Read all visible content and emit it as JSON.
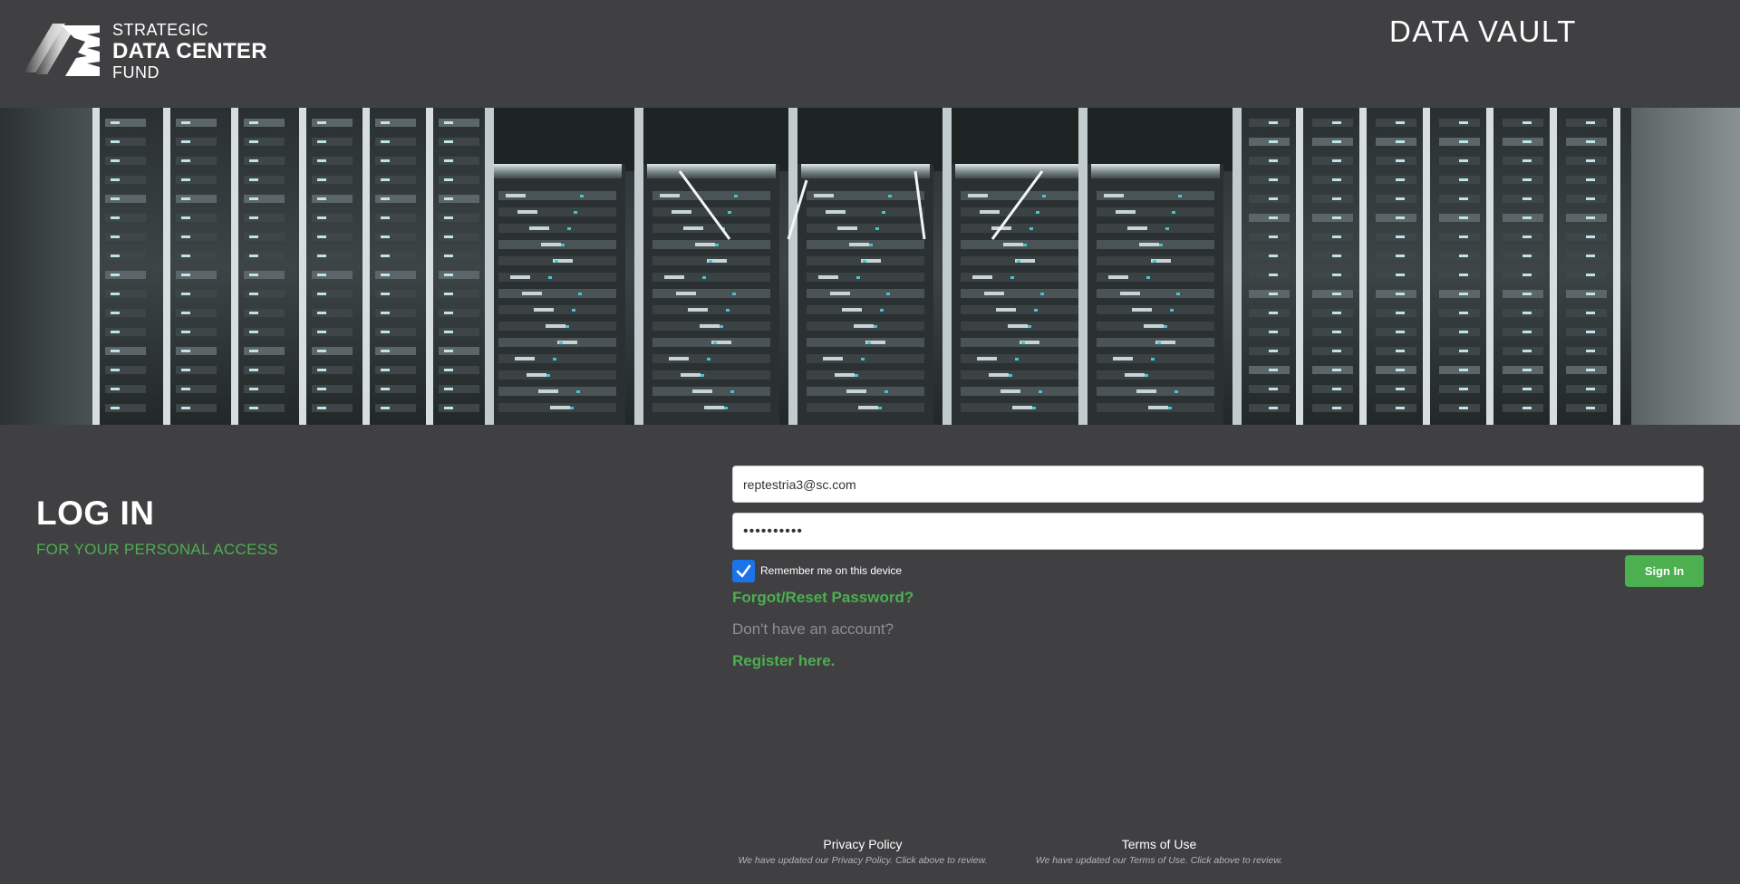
{
  "header": {
    "logo": {
      "line1": "STRATEGIC",
      "line2": "DATA CENTER",
      "line3": "FUND"
    },
    "app_title": "DATA VAULT"
  },
  "banner": {
    "icon": "server-room-banner"
  },
  "login": {
    "heading": "LOG IN",
    "subheading": "FOR YOUR PERSONAL ACCESS"
  },
  "form": {
    "email_value": "reptestria3@sc.com",
    "password_value": "••••••••••",
    "remember_label": "Remember me on this device",
    "remember_checked": true,
    "signin_label": "Sign In",
    "forgot_label": "Forgot/Reset Password?",
    "no_account_text": "Don't have an account?",
    "register_label": "Register here."
  },
  "footer": {
    "privacy_label": "Privacy Policy",
    "privacy_note": "We have updated our Privacy Policy. Click above to review.",
    "terms_label": "Terms of Use",
    "terms_note": "We have updated our Terms of Use. Click above to review."
  },
  "colors": {
    "background": "#404042",
    "accent": "#4caf50",
    "checkbox": "#1a73e8",
    "muted_text": "#8e8e90"
  }
}
